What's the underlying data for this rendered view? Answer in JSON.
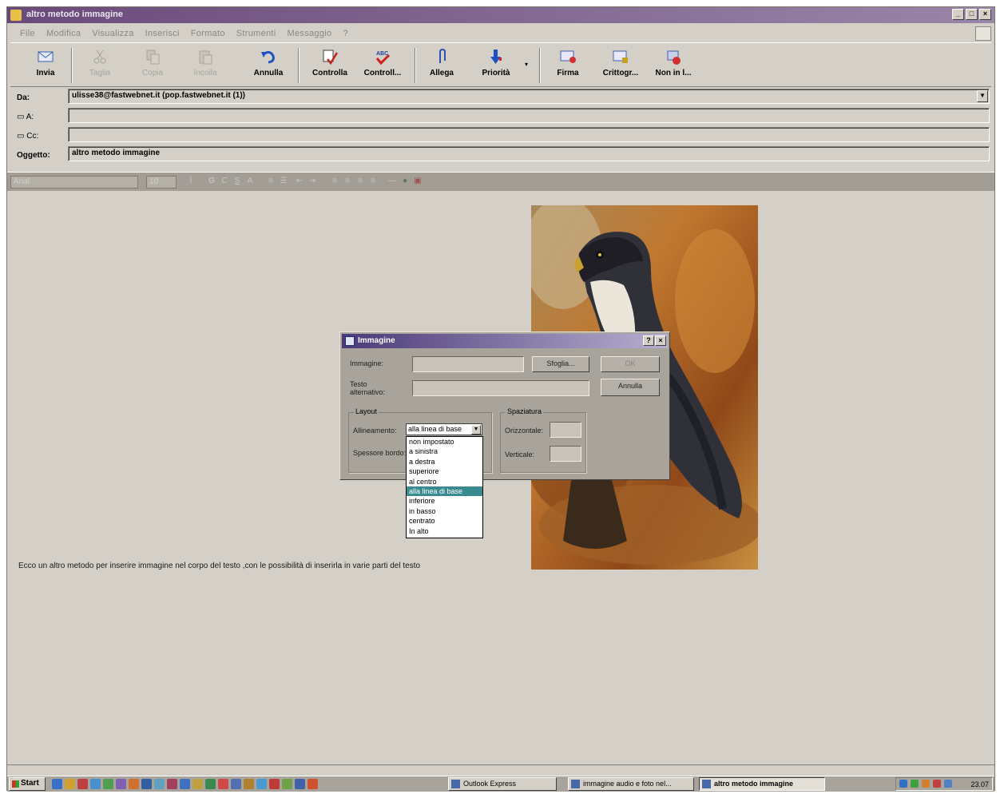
{
  "window": {
    "title": "altro metodo immagine",
    "controls": [
      "_",
      "□",
      "×"
    ]
  },
  "menu": [
    "File",
    "Modifica",
    "Visualizza",
    "Inserisci",
    "Formato",
    "Strumenti",
    "Messaggio",
    "?"
  ],
  "toolbar": {
    "buttons": [
      {
        "label": "Invia",
        "icon": "send-icon",
        "enabled": true
      },
      {
        "label": "Taglia",
        "icon": "cut-icon",
        "enabled": false
      },
      {
        "label": "Copia",
        "icon": "copy-icon",
        "enabled": false
      },
      {
        "label": "Incolla",
        "icon": "paste-icon",
        "enabled": false
      },
      {
        "label": "Annulla",
        "icon": "undo-icon",
        "enabled": true
      },
      {
        "label": "Controlla",
        "icon": "check-names-icon",
        "enabled": true
      },
      {
        "label": "Controll...",
        "icon": "spelling-icon",
        "enabled": true
      },
      {
        "label": "Allega",
        "icon": "paperclip-icon",
        "enabled": true
      },
      {
        "label": "Priorità",
        "icon": "priority-icon",
        "enabled": true
      },
      {
        "label": "Firma",
        "icon": "sign-icon",
        "enabled": true
      },
      {
        "label": "Crittogr...",
        "icon": "encrypt-icon",
        "enabled": true
      },
      {
        "label": "Non in l...",
        "icon": "offline-icon",
        "enabled": true
      }
    ]
  },
  "header": {
    "from_label": "Da:",
    "from_value": "ulisse38@fastwebnet.it    (pop.fastwebnet.it (1))",
    "to_label": "A:",
    "to_value": "",
    "cc_label": "Cc:",
    "cc_value": "",
    "subject_label": "Oggetto:",
    "subject_value": "altro metodo immagine"
  },
  "format": {
    "font": "Arial",
    "size": "10"
  },
  "body": {
    "text": "Ecco un altro metodo per inserire immagine nel corpo del testo ,con le possibilità di inserirla in varie parti del testo"
  },
  "dialog": {
    "title": "Immagine",
    "help": "?",
    "close": "×",
    "image_label": "Immagine:",
    "browse_label": "Sfoglia...",
    "ok_label": "OK",
    "cancel_label": "Annulla",
    "alt_label_1": "Testo",
    "alt_label_2": "alternativo:",
    "layout_title": "Layout",
    "align_label": "Allineamento:",
    "border_label": "Spessore bordo:",
    "align_value": "alla linea di base",
    "spacing_title": "Spaziatura",
    "horizontal_label": "Orizzontale:",
    "vertical_label": "Verticale:",
    "align_options": [
      "non impostato",
      "a sinistra",
      "a destra",
      "superiore",
      "al centro",
      "alla linea di base",
      "inferiore",
      "in basso",
      "centrato",
      "In alto"
    ],
    "selected_index": 5
  },
  "taskbar": {
    "start": "Start",
    "tasks": [
      {
        "label": "Outlook Express",
        "active": false
      },
      {
        "label": "immagine audio e foto nel...",
        "active": false
      },
      {
        "label": "altro metodo immagine",
        "active": true
      }
    ],
    "clock": "23.07"
  },
  "colors": {
    "titlebar": "#6a4a7a",
    "dialog_title": "#4a3a78",
    "selected_option": "#3a8a92",
    "window_bg": "#d4d0c8"
  }
}
